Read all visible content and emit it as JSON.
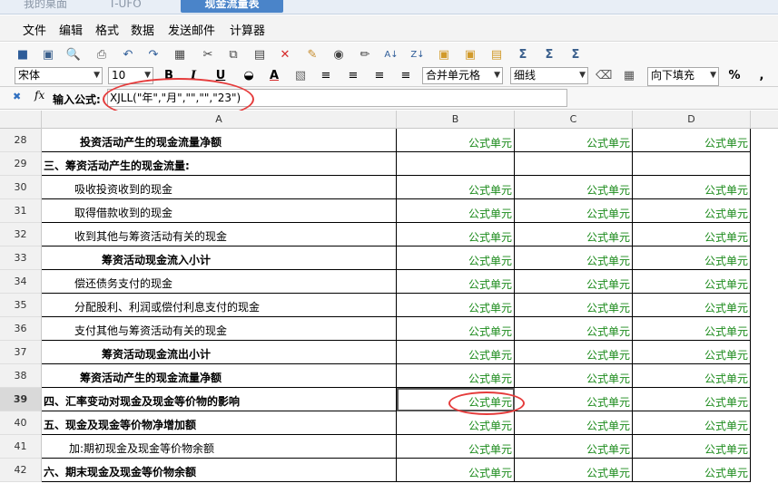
{
  "tabs": [
    {
      "label": "我的桌面"
    },
    {
      "label": "T-UFO"
    },
    {
      "label": "现金流量表"
    }
  ],
  "menu": [
    "文件",
    "编辑",
    "格式",
    "数据",
    "发送邮件",
    "计算器"
  ],
  "toolbar": {
    "font": "宋体",
    "size": "10",
    "bold": "B",
    "italic": "I",
    "underline": "U",
    "merge": "合并单元格",
    "border": "细线",
    "fill": "向下填充",
    "percent": "%",
    "comma": ","
  },
  "formula": {
    "fx": "fx",
    "label": "输入公式:",
    "value": "XJLL(\"年\",\"月\",\"\",\"\",\"23\")"
  },
  "columns": [
    "A",
    "B",
    "C",
    "D"
  ],
  "cell_text": "公式单元",
  "rows": [
    {
      "num": "28",
      "label": "投资活动产生的现金流量净额",
      "style": "bold",
      "indent": "l2",
      "b": "公式单元",
      "c": "公式单元",
      "d": "公式单元"
    },
    {
      "num": "29",
      "label": "三、筹资活动产生的现金流量:",
      "style": "bold",
      "indent": "l0",
      "b": "",
      "c": "",
      "d": ""
    },
    {
      "num": "30",
      "label": "吸收投资收到的现金",
      "style": "",
      "indent": "l1",
      "b": "公式单元",
      "c": "公式单元",
      "d": "公式单元"
    },
    {
      "num": "31",
      "label": "取得借款收到的现金",
      "style": "",
      "indent": "l1",
      "b": "公式单元",
      "c": "公式单元",
      "d": "公式单元"
    },
    {
      "num": "32",
      "label": "收到其他与筹资活动有关的现金",
      "style": "",
      "indent": "l1",
      "b": "公式单元",
      "c": "公式单元",
      "d": "公式单元"
    },
    {
      "num": "33",
      "label": "筹资活动现金流入小计",
      "style": "bold",
      "indent": "l3",
      "b": "公式单元",
      "c": "公式单元",
      "d": "公式单元"
    },
    {
      "num": "34",
      "label": "偿还债务支付的现金",
      "style": "",
      "indent": "l1",
      "b": "公式单元",
      "c": "公式单元",
      "d": "公式单元"
    },
    {
      "num": "35",
      "label": "分配股利、利润或偿付利息支付的现金",
      "style": "",
      "indent": "l1",
      "b": "公式单元",
      "c": "公式单元",
      "d": "公式单元"
    },
    {
      "num": "36",
      "label": "支付其他与筹资活动有关的现金",
      "style": "",
      "indent": "l1",
      "b": "公式单元",
      "c": "公式单元",
      "d": "公式单元"
    },
    {
      "num": "37",
      "label": "筹资活动现金流出小计",
      "style": "bold",
      "indent": "l3",
      "b": "公式单元",
      "c": "公式单元",
      "d": "公式单元"
    },
    {
      "num": "38",
      "label": "筹资活动产生的现金流量净额",
      "style": "bold",
      "indent": "l2",
      "b": "公式单元",
      "c": "公式单元",
      "d": "公式单元"
    },
    {
      "num": "39",
      "label": "四、汇率变动对现金及现金等价物的影响",
      "style": "bold",
      "indent": "l0",
      "b": "公式单元",
      "c": "公式单元",
      "d": "公式单元"
    },
    {
      "num": "40",
      "label": "五、现金及现金等价物净增加额",
      "style": "bold",
      "indent": "l0",
      "b": "公式单元",
      "c": "公式单元",
      "d": "公式单元"
    },
    {
      "num": "41",
      "label": "加:期初现金及现金等价物余额",
      "style": "",
      "indent": "l1b",
      "b": "公式单元",
      "c": "公式单元",
      "d": "公式单元"
    },
    {
      "num": "42",
      "label": "六、期末现金及现金等价物余额",
      "style": "bold",
      "indent": "l0",
      "b": "公式单元",
      "c": "公式单元",
      "d": "公式单元"
    }
  ],
  "selected_row": "39",
  "colors": {
    "accent": "#4a84c9",
    "formula_green": "#1a8a1a",
    "annotation_red": "#e53b3b"
  }
}
